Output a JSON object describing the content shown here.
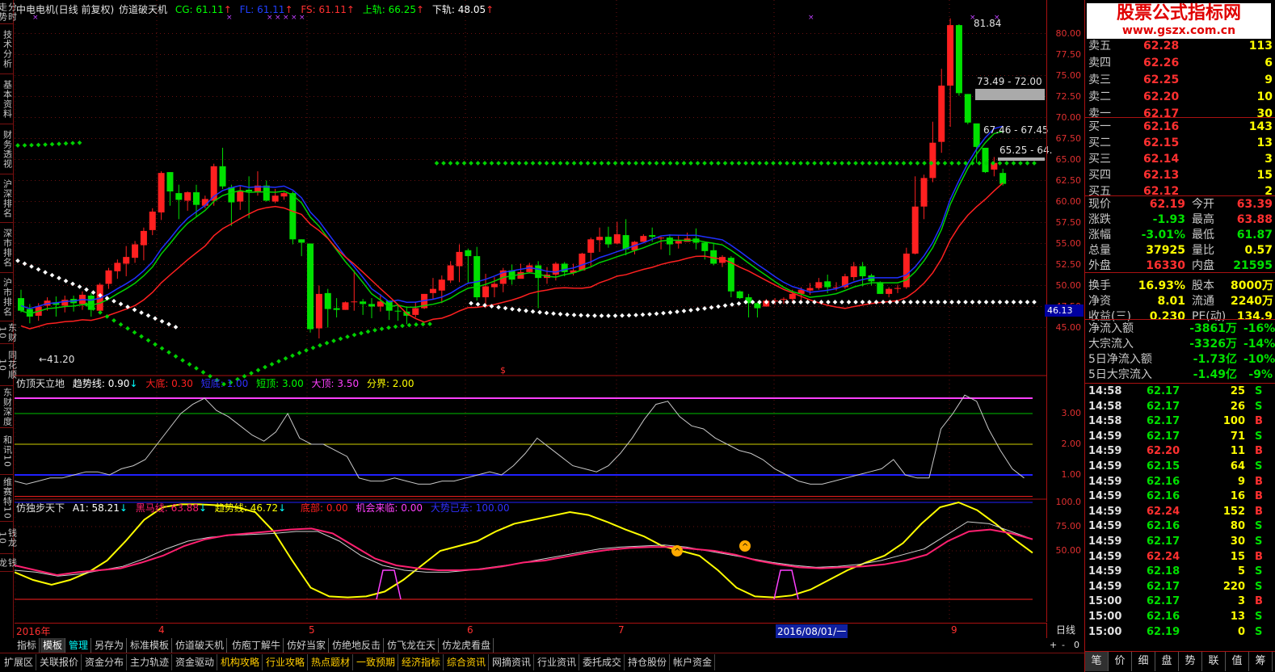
{
  "left_nav": [
    "分时走势",
    "技术分析",
    "基本资料",
    "财务透视",
    "沪深排名",
    "深市排名",
    "沪市排名",
    "东财10",
    "同花顺10",
    "东财深度",
    "和讯10",
    "维赛特10",
    "钱龙10",
    "钱龙"
  ],
  "main_header": {
    "title": "中电电机(日线 前复权)",
    "indicator": "仿道破天机",
    "cg": "CG: 61.11",
    "fl": "FL: 61.11",
    "fs": "FS: 61.11",
    "upper": "上轨: 66.25",
    "lower": "下轨: 48.05",
    "arrow_up": "↑",
    "arrow_down": "↑"
  },
  "price_labels": {
    "high": "81.84",
    "low": "←41.20",
    "box1": "73.49 - 72.00",
    "box2": "67.46 - 67.45",
    "box3": "65.25 - 64.",
    "cur": "46.13",
    "dollar": "$"
  },
  "y_axis_main": [
    "80.00",
    "77.50",
    "75.00",
    "72.50",
    "70.00",
    "67.50",
    "65.00",
    "62.50",
    "60.00",
    "57.50",
    "55.00",
    "52.50",
    "50.00",
    "47.50",
    "45.00"
  ],
  "ind1": {
    "name": "仿顶天立地",
    "trend": "趋势线: 0.90",
    "bottom": "大底: 0.30",
    "short_bot": "短底: 1.00",
    "short_top": "短顶: 3.00",
    "top": "大顶: 3.50",
    "div": "分界: 2.00",
    "ticks": [
      "3.00",
      "2.00",
      "1.00"
    ]
  },
  "ind2": {
    "name": "仿独步天下",
    "a1": "A1: 58.21",
    "hm": "黑马线: 63.88",
    "trend": "趋势线: 46.72",
    "bottom": "底部: 0.00",
    "chance": "机会来临: 0.00",
    "trend_gone": "大势已去: 100.00",
    "ticks": [
      "100.0",
      "75.00",
      "50.00"
    ]
  },
  "time_axis": {
    "labels": [
      "2016年",
      "4",
      "5",
      "6",
      "7",
      "2016/08/01/一",
      "9"
    ],
    "period": "日线",
    "plus": "+",
    "minus": "-",
    "zero": "0"
  },
  "bottom_tabs1": [
    "指标",
    "模板",
    "管理",
    "另存为",
    "标准模板",
    "仿道破天机",
    "仿庖丁解牛",
    "仿好当家",
    "仿绝地反击",
    "仿飞龙在天",
    "仿龙虎看盘"
  ],
  "bottom_tabs2": [
    "扩展区",
    "关联报价",
    "资金分布",
    "主力轨迹",
    "资金驱动",
    "机构攻略",
    "行业攻略",
    "热点题材",
    "一致预期",
    "经济指标",
    "综合资讯",
    "网摘资讯",
    "行业资讯",
    "委托成交",
    "持仓股份",
    "帐户资金"
  ],
  "logo": {
    "line1": "股票公式指标网",
    "line2": "www.gszx.com.cn"
  },
  "orderbook": [
    {
      "label": "卖五",
      "price": "62.28",
      "vol": "113"
    },
    {
      "label": "卖四",
      "price": "62.26",
      "vol": "6"
    },
    {
      "label": "卖三",
      "price": "62.25",
      "vol": "9"
    },
    {
      "label": "卖二",
      "price": "62.20",
      "vol": "10"
    },
    {
      "label": "卖一",
      "price": "62.17",
      "vol": "30"
    },
    {
      "label": "买一",
      "price": "62.16",
      "vol": "143"
    },
    {
      "label": "买二",
      "price": "62.15",
      "vol": "13"
    },
    {
      "label": "买三",
      "price": "62.14",
      "vol": "3"
    },
    {
      "label": "买四",
      "price": "62.13",
      "vol": "15"
    },
    {
      "label": "买五",
      "price": "62.12",
      "vol": "2"
    }
  ],
  "stats": [
    {
      "k1": "现价",
      "v1": "62.19",
      "k2": "今开",
      "v2": "63.39",
      "c1": "#ff3030",
      "c2": "#ff3030"
    },
    {
      "k1": "涨跌",
      "v1": "-1.93",
      "k2": "最高",
      "v2": "63.88",
      "c1": "#00e000",
      "c2": "#ff3030"
    },
    {
      "k1": "涨幅",
      "v1": "-3.01%",
      "k2": "最低",
      "v2": "61.87",
      "c1": "#00e000",
      "c2": "#00e000"
    },
    {
      "k1": "总量",
      "v1": "37925",
      "k2": "量比",
      "v2": "0.57",
      "c1": "#ffff00",
      "c2": "#ffff00"
    },
    {
      "k1": "外盘",
      "v1": "16330",
      "k2": "内盘",
      "v2": "21595",
      "c1": "#ff3030",
      "c2": "#00e000"
    },
    {
      "k1": "换手",
      "v1": "16.93%",
      "k2": "股本",
      "v2": "8000万",
      "c1": "#ffff00",
      "c2": "#ffff00"
    },
    {
      "k1": "净资",
      "v1": "8.01",
      "k2": "流通",
      "v2": "2240万",
      "c1": "#ffff00",
      "c2": "#ffff00"
    },
    {
      "k1": "收益(三)",
      "v1": "0.230",
      "k2": "PE(动)",
      "v2": "134.9",
      "c1": "#ffff00",
      "c2": "#ffff00"
    }
  ],
  "flows": [
    {
      "k": "净流入额",
      "v": "-3861万",
      "p": "-16%"
    },
    {
      "k": "大宗流入",
      "v": "-3326万",
      "p": "-14%"
    },
    {
      "k": "5日净流入额",
      "v": "-1.73亿",
      "p": "-10%"
    },
    {
      "k": "5日大宗流入",
      "v": "-1.49亿",
      "p": "-9%"
    }
  ],
  "ticks": [
    {
      "t": "14:58",
      "p": "62.17",
      "v": "25",
      "s": "S"
    },
    {
      "t": "14:58",
      "p": "62.17",
      "v": "26",
      "s": "S"
    },
    {
      "t": "14:58",
      "p": "62.17",
      "v": "100",
      "s": "B"
    },
    {
      "t": "14:59",
      "p": "62.17",
      "v": "71",
      "s": "S"
    },
    {
      "t": "14:59",
      "p": "62.20",
      "v": "11",
      "s": "B"
    },
    {
      "t": "14:59",
      "p": "62.15",
      "v": "64",
      "s": "S"
    },
    {
      "t": "14:59",
      "p": "62.16",
      "v": "9",
      "s": "B"
    },
    {
      "t": "14:59",
      "p": "62.16",
      "v": "16",
      "s": "B"
    },
    {
      "t": "14:59",
      "p": "62.24",
      "v": "152",
      "s": "B"
    },
    {
      "t": "14:59",
      "p": "62.16",
      "v": "80",
      "s": "S"
    },
    {
      "t": "14:59",
      "p": "62.17",
      "v": "30",
      "s": "S"
    },
    {
      "t": "14:59",
      "p": "62.24",
      "v": "15",
      "s": "B"
    },
    {
      "t": "14:59",
      "p": "62.18",
      "v": "5",
      "s": "S"
    },
    {
      "t": "14:59",
      "p": "62.17",
      "v": "220",
      "s": "S"
    },
    {
      "t": "15:00",
      "p": "62.17",
      "v": "3",
      "s": "B"
    },
    {
      "t": "15:00",
      "p": "62.16",
      "v": "13",
      "s": "S"
    },
    {
      "t": "15:00",
      "p": "62.19",
      "v": "0",
      "s": "S"
    }
  ],
  "right_tabs": [
    "笔",
    "价",
    "细",
    "盘",
    "势",
    "联",
    "值",
    "筹"
  ],
  "candles": [
    [
      48.5,
      47.0,
      49.5,
      46.8
    ],
    [
      47.2,
      46.3,
      47.8,
      45.5
    ],
    [
      46.4,
      47.5,
      47.9,
      45.8
    ],
    [
      47.6,
      48.2,
      48.6,
      47.0
    ],
    [
      48.0,
      47.7,
      48.7,
      46.3
    ],
    [
      47.6,
      48.3,
      48.8,
      46.8
    ],
    [
      48.4,
      47.9,
      48.8,
      46.9
    ],
    [
      47.8,
      48.9,
      49.3,
      47.1
    ],
    [
      48.8,
      47.1,
      49.1,
      46.3
    ],
    [
      47.0,
      50.1,
      50.3,
      46.7
    ],
    [
      50.2,
      51.8,
      52.1,
      49.6
    ],
    [
      51.7,
      52.7,
      53.1,
      50.8
    ],
    [
      52.6,
      53.4,
      54.7,
      51.1
    ],
    [
      53.3,
      54.9,
      55.3,
      52.7
    ],
    [
      54.8,
      56.5,
      56.9,
      53.0
    ],
    [
      56.6,
      58.8,
      59.2,
      56.0
    ],
    [
      58.7,
      63.4,
      63.6,
      57.8
    ],
    [
      63.5,
      61.2,
      63.5,
      59.5
    ],
    [
      61.0,
      60.2,
      62.0,
      57.9
    ],
    [
      60.1,
      61.1,
      61.2,
      58.9
    ],
    [
      61.1,
      59.6,
      62.0,
      58.2
    ],
    [
      59.5,
      60.3,
      60.7,
      59.2
    ],
    [
      60.1,
      64.2,
      64.5,
      59.5
    ],
    [
      64.2,
      61.8,
      66.4,
      61.5
    ],
    [
      61.7,
      59.9,
      62.0,
      57.1
    ],
    [
      60.0,
      61.3,
      61.9,
      59.0
    ],
    [
      61.4,
      61.2,
      63.0,
      58.0
    ],
    [
      61.2,
      61.9,
      63.6,
      60.7
    ],
    [
      61.9,
      60.1,
      62.5,
      60.0
    ],
    [
      60.0,
      60.7,
      61.5,
      59.8
    ],
    [
      60.6,
      61.0,
      61.1,
      60.2
    ],
    [
      61.0,
      55.5,
      61.2,
      54.9
    ],
    [
      55.5,
      55.1,
      55.5,
      53.5
    ],
    [
      55.0,
      44.8,
      52.3,
      44.4
    ],
    [
      44.9,
      49.0,
      50.0,
      43.7
    ],
    [
      49.1,
      47.2,
      49.6,
      45.0
    ],
    [
      47.3,
      47.1,
      48.5,
      46.2
    ],
    [
      47.1,
      48.0,
      48.1,
      47.1
    ],
    [
      48.1,
      48.1,
      51.8,
      47.0
    ],
    [
      48.1,
      47.8,
      48.4,
      46.5
    ],
    [
      47.8,
      47.5,
      48.5,
      46.1
    ],
    [
      47.5,
      48.1,
      49.0,
      46.9
    ],
    [
      48.2,
      47.0,
      48.2,
      45.9
    ],
    [
      47.0,
      46.9,
      47.8,
      45.8
    ],
    [
      46.9,
      46.4,
      47.5,
      45.4
    ],
    [
      46.5,
      47.3,
      48.0,
      46.2
    ],
    [
      47.3,
      49.0,
      49.0,
      47.2
    ],
    [
      49.1,
      49.6,
      50.9,
      48.4
    ],
    [
      49.4,
      50.7,
      51.2,
      47.9
    ],
    [
      50.6,
      52.4,
      52.9,
      50.3
    ],
    [
      52.3,
      54.0,
      54.9,
      50.4
    ],
    [
      54.2,
      53.5,
      54.4,
      50.3
    ],
    [
      53.5,
      48.6,
      54.6,
      48.2
    ],
    [
      48.6,
      49.9,
      51.4,
      47.3
    ],
    [
      49.8,
      50.2,
      51.0,
      48.6
    ],
    [
      50.2,
      51.8,
      52.1,
      49.2
    ],
    [
      51.8,
      50.7,
      52.5,
      50.1
    ],
    [
      50.8,
      51.6,
      52.6,
      51.4
    ],
    [
      51.6,
      52.4,
      52.7,
      51.5
    ],
    [
      52.4,
      50.9,
      52.9,
      47.3
    ],
    [
      50.9,
      51.3,
      52.2,
      50.2
    ],
    [
      51.3,
      52.6,
      52.8,
      50.6
    ],
    [
      52.6,
      51.6,
      52.8,
      51.1
    ],
    [
      51.5,
      51.8,
      52.6,
      51.2
    ],
    [
      51.8,
      53.8,
      53.9,
      51.9
    ],
    [
      53.9,
      55.5,
      55.7,
      52.3
    ],
    [
      55.4,
      55.8,
      56.9,
      54.0
    ],
    [
      55.8,
      54.9,
      57.0,
      54.5
    ],
    [
      55.0,
      56.1,
      57.6,
      54.9
    ],
    [
      56.0,
      54.3,
      57.9,
      53.6
    ],
    [
      54.2,
      55.2,
      55.3,
      53.7
    ],
    [
      55.2,
      55.9,
      56.1,
      55.2
    ],
    [
      56.0,
      55.8,
      56.9,
      55.2
    ],
    [
      55.7,
      55.7,
      55.8,
      54.3
    ],
    [
      55.7,
      54.9,
      56.1,
      53.6
    ],
    [
      55.0,
      55.3,
      55.9,
      54.4
    ],
    [
      55.2,
      55.6,
      56.3,
      55.3
    ],
    [
      55.6,
      55.1,
      56.8,
      54.3
    ],
    [
      55.1,
      54.1,
      55.2,
      53.1
    ],
    [
      54.2,
      52.6,
      55.1,
      52.4
    ],
    [
      52.7,
      53.4,
      53.6,
      52.2
    ],
    [
      53.3,
      49.3,
      53.5,
      48.6
    ],
    [
      49.3,
      48.5,
      49.4,
      48.4
    ],
    [
      48.6,
      47.9,
      49.0,
      46.2
    ],
    [
      47.9,
      47.3,
      48.0,
      46.2
    ],
    [
      47.5,
      48.2,
      48.4,
      47.7
    ],
    [
      48.2,
      48.2,
      48.5,
      47.7
    ],
    [
      48.3,
      48.4,
      48.6,
      47.8
    ],
    [
      48.4,
      49.0,
      49.5,
      47.9
    ],
    [
      49.0,
      49.5,
      49.8,
      48.0
    ],
    [
      49.4,
      49.7,
      50.3,
      48.9
    ],
    [
      49.7,
      50.4,
      50.9,
      49.5
    ],
    [
      50.5,
      49.8,
      51.3,
      49.1
    ],
    [
      49.8,
      49.8,
      50.4,
      49.4
    ],
    [
      49.8,
      51.1,
      51.4,
      49.6
    ],
    [
      51.0,
      52.3,
      52.8,
      50.6
    ],
    [
      52.3,
      51.1,
      52.8,
      49.9
    ],
    [
      51.2,
      50.5,
      51.4,
      50.0
    ],
    [
      50.4,
      49.0,
      50.5,
      49.0
    ],
    [
      49.0,
      49.6,
      49.8,
      48.6
    ],
    [
      49.6,
      49.7,
      50.1,
      49.1
    ],
    [
      49.8,
      53.8,
      54.5,
      49.6
    ],
    [
      53.8,
      59.4,
      63.0,
      53.7
    ],
    [
      59.4,
      62.8,
      63.2,
      57.9
    ],
    [
      62.8,
      67.0,
      69.5,
      62.3
    ],
    [
      67.1,
      73.8,
      75.8,
      65.8
    ],
    [
      73.8,
      81.0,
      81.8,
      68.9
    ],
    [
      81.0,
      72.9,
      81.1,
      72.6
    ],
    [
      72.8,
      69.4,
      72.8,
      69.2
    ],
    [
      69.3,
      66.5,
      67.8,
      64.6
    ],
    [
      66.4,
      63.5,
      65.4,
      63.4
    ],
    [
      63.8,
      64.6,
      65.3,
      63.0
    ],
    [
      63.4,
      62.1,
      63.9,
      61.9
    ]
  ]
}
